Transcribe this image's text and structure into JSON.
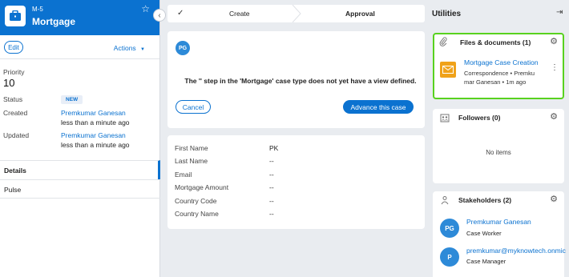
{
  "case": {
    "id": "M-5",
    "title": "Mortgage",
    "edit_label": "Edit",
    "actions_label": "Actions",
    "priority_label": "Priority",
    "priority_value": "10",
    "status_label": "Status",
    "status_value": "NEW",
    "created_label": "Created",
    "created_by": "Premkumar Ganesan",
    "created_when": "less than a minute ago",
    "updated_label": "Updated",
    "updated_by": "Premkumar Ganesan",
    "updated_when": "less than a minute ago",
    "nav": [
      {
        "label": "Details"
      },
      {
        "label": "Pulse"
      }
    ]
  },
  "stepper": {
    "steps": [
      {
        "label": "Create"
      },
      {
        "label": "Approval"
      }
    ]
  },
  "assignment": {
    "avatar_initials": "PG",
    "message": "The '' step in the 'Mortgage' case type does not yet have a view defined.",
    "cancel_label": "Cancel",
    "advance_label": "Advance this case"
  },
  "details": {
    "fields": [
      {
        "label": "First Name",
        "value": "PK"
      },
      {
        "label": "Last Name",
        "value": "--"
      },
      {
        "label": "Email",
        "value": "--"
      },
      {
        "label": "Mortgage Amount",
        "value": "--"
      },
      {
        "label": "Country Code",
        "value": "--"
      },
      {
        "label": "Country Name",
        "value": "--"
      }
    ]
  },
  "utilities": {
    "title": "Utilities",
    "files": {
      "title": "Files & documents (1)",
      "item_title": "Mortgage Case Creation",
      "item_meta_line1": "Correspondence • Premku",
      "item_meta_line2": "mar Ganesan • 1m ago"
    },
    "followers": {
      "title": "Followers (0)",
      "empty_text": "No items"
    },
    "stakeholders": {
      "title": "Stakeholders (2)",
      "people": [
        {
          "initials": "PG",
          "name": "Premkumar Ganesan",
          "role": "Case Worker"
        },
        {
          "initials": "P",
          "name": "premkumar@myknowtech.onmic",
          "role": "Case Manager"
        }
      ]
    }
  },
  "colors": {
    "accent": "#0b72d0",
    "highlight": "#58d21f",
    "mail_icon": "#f0a21a"
  }
}
